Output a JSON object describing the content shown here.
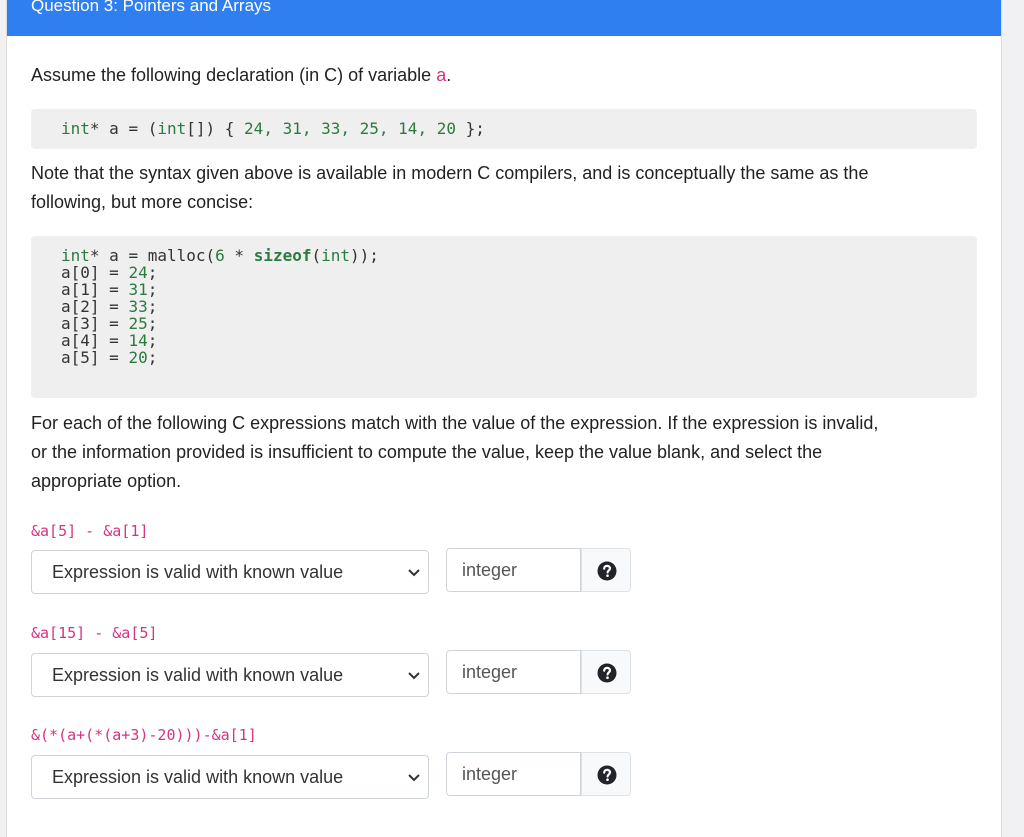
{
  "header": {
    "title": "Question 3: Pointers and Arrays"
  },
  "intro": {
    "text_before": "Assume the following declaration (in C) of variable ",
    "variable": "a",
    "text_after": "."
  },
  "code1": {
    "type": "int",
    "decl": "* a = (",
    "type2": "int",
    "decl2": "[]) { ",
    "values": "24, 31, 33, 25, 14, 20",
    "end": " };"
  },
  "note": {
    "line1": "Note that the syntax given above is available in modern C compilers, and is conceptually the same as the",
    "line2": "following, but more concise:"
  },
  "code2": {
    "line1_a": "int",
    "line1_b": "* a = malloc(",
    "line1_c": "6",
    "line1_d": " * ",
    "line1_e": "sizeof",
    "line1_f": "(",
    "line1_g": "int",
    "line1_h": "));",
    "assignments": [
      {
        "lhs": "a[0] = ",
        "val": "24",
        "end": ";"
      },
      {
        "lhs": "a[1] = ",
        "val": "31",
        "end": ";"
      },
      {
        "lhs": "a[2] = ",
        "val": "33",
        "end": ";"
      },
      {
        "lhs": "a[3] = ",
        "val": "25",
        "end": ";"
      },
      {
        "lhs": "a[4] = ",
        "val": "14",
        "end": ";"
      },
      {
        "lhs": "a[5] = ",
        "val": "20",
        "end": ";"
      }
    ]
  },
  "instructions": {
    "line1": "For each of the following C expressions match with the value of the expression. If the expression is invalid,",
    "line2": "or the information provided is insufficient to compute the value, keep the value blank, and select the",
    "line3": "appropriate option."
  },
  "questions": [
    {
      "expression": "&a[5] - &a[1]",
      "selected": "Expression is valid with known value",
      "placeholder": "integer"
    },
    {
      "expression": "&a[15] - &a[5]",
      "selected": "Expression is valid with known value",
      "placeholder": "integer"
    },
    {
      "expression": "&(*(a+(*(a+3)-20)))-&a[1]",
      "selected": "Expression is valid with known value",
      "placeholder": "integer"
    }
  ],
  "icons": {
    "help": "question-circle-icon",
    "chevron": "chevron-down-icon"
  }
}
